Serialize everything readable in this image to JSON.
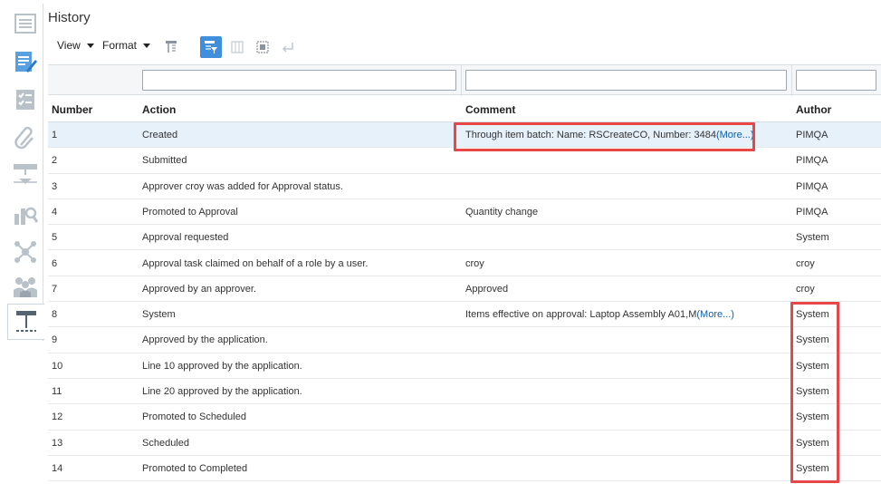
{
  "header": {
    "title": "History"
  },
  "toolbar": {
    "view_label": "View",
    "format_label": "Format",
    "icons": [
      "freeze-icon",
      "query-by-example-icon",
      "column-icon",
      "detach-icon",
      "wrap-icon"
    ]
  },
  "sidebar": {
    "icons": [
      "overview-icon",
      "edit-document-icon",
      "checklist-icon",
      "attachment-icon",
      "flow-icon",
      "analytics-icon",
      "network-icon",
      "team-icon",
      "history-icon"
    ]
  },
  "table": {
    "columns": {
      "number": "Number",
      "action": "Action",
      "comment": "Comment",
      "author": "Author"
    },
    "filter_values": {
      "number": "",
      "action": "",
      "comment": "",
      "author": ""
    },
    "rows": [
      {
        "number": "1",
        "action": "Created",
        "comment": "Through item batch: Name: RSCreateCO, Number: 3484",
        "more": "(More...)",
        "author": "PIMQA"
      },
      {
        "number": "2",
        "action": "Submitted",
        "comment": "",
        "more": "",
        "author": "PIMQA"
      },
      {
        "number": "3",
        "action": "Approver croy was added for Approval status.",
        "comment": "",
        "more": "",
        "author": "PIMQA"
      },
      {
        "number": "4",
        "action": "Promoted to Approval",
        "comment": "Quantity change",
        "more": "",
        "author": "PIMQA"
      },
      {
        "number": "5",
        "action": "Approval requested",
        "comment": "",
        "more": "",
        "author": "System"
      },
      {
        "number": "6",
        "action": "Approval task claimed on behalf of a role by a user.",
        "comment": "croy",
        "more": "",
        "author": "croy"
      },
      {
        "number": "7",
        "action": "Approved by an approver.",
        "comment": "Approved",
        "more": "",
        "author": "croy"
      },
      {
        "number": "8",
        "action": "System",
        "comment": "Items effective on approval: Laptop Assembly A01,M",
        "more": "(More...)",
        "author": "System"
      },
      {
        "number": "9",
        "action": "Approved by the application.",
        "comment": "",
        "more": "",
        "author": "System"
      },
      {
        "number": "10",
        "action": "Line 10 approved by the application.",
        "comment": "",
        "more": "",
        "author": "System"
      },
      {
        "number": "11",
        "action": "Line 20 approved by the application.",
        "comment": "",
        "more": "",
        "author": "System"
      },
      {
        "number": "12",
        "action": "Promoted to Scheduled",
        "comment": "",
        "more": "",
        "author": "System"
      },
      {
        "number": "13",
        "action": "Scheduled",
        "comment": "",
        "more": "",
        "author": "System"
      },
      {
        "number": "14",
        "action": "Promoted to Completed",
        "comment": "",
        "more": "",
        "author": "System"
      }
    ]
  },
  "colors": {
    "accent": "#3f8fdc",
    "highlight": "#e8474a",
    "selected_row": "#e6f1fa",
    "link": "#0d5fa8"
  }
}
